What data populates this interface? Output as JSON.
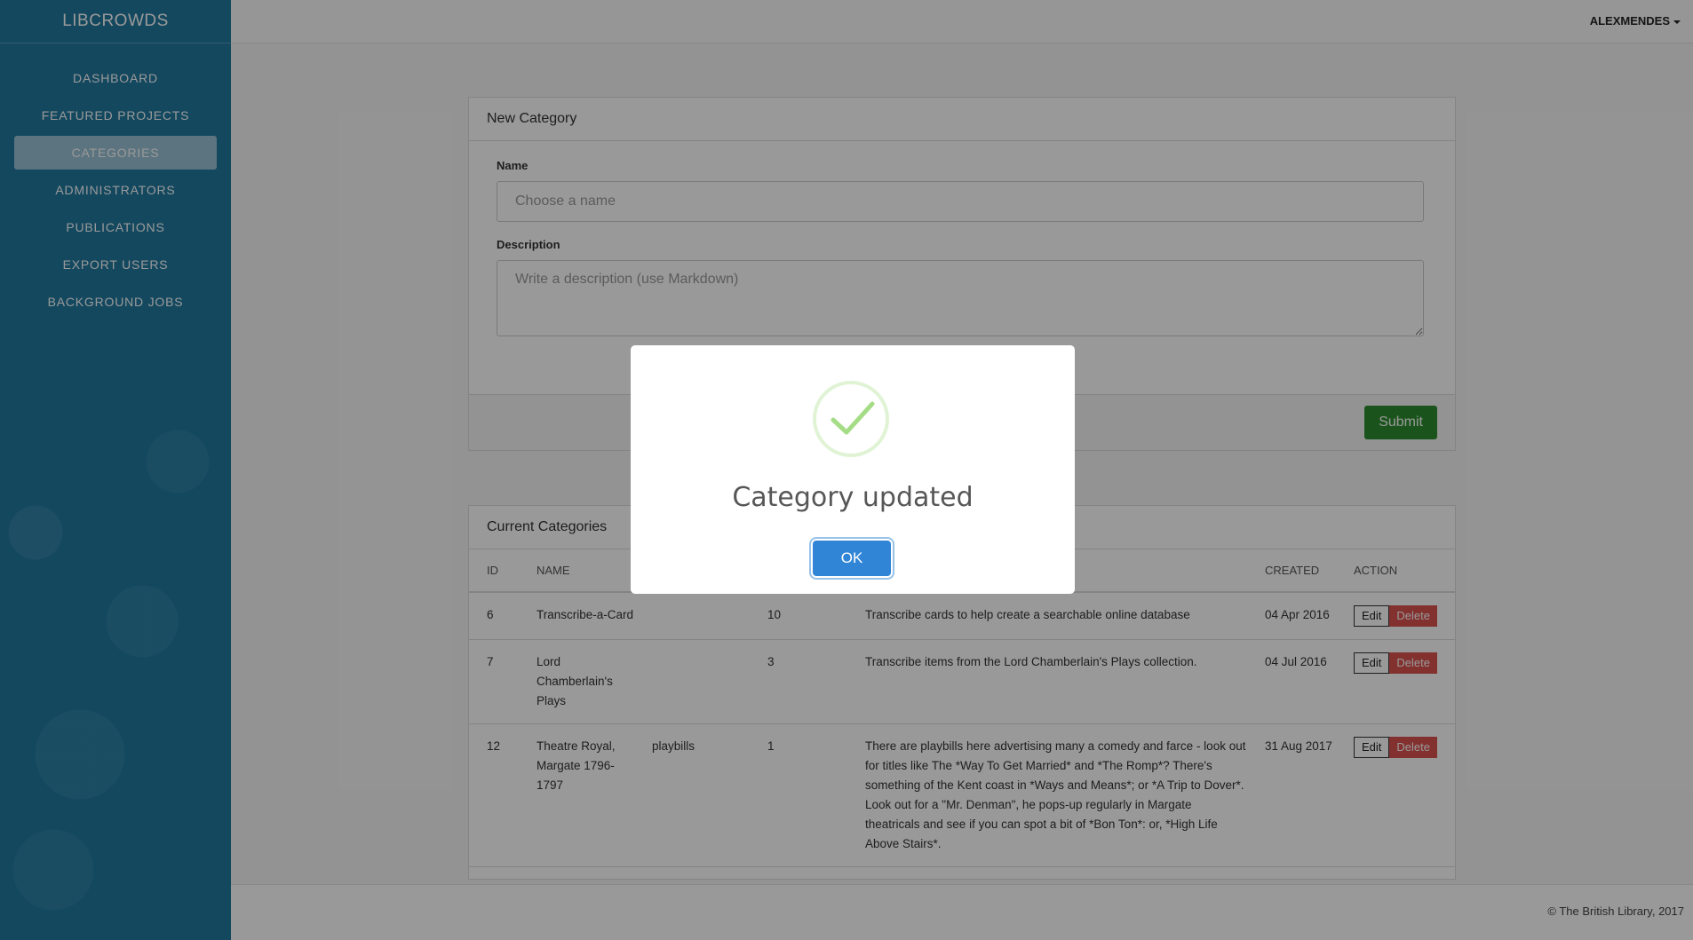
{
  "sidebar": {
    "brand": "LIBCROWDS",
    "items": [
      {
        "label": "DASHBOARD"
      },
      {
        "label": "FEATURED PROJECTS"
      },
      {
        "label": "CATEGORIES",
        "active": true
      },
      {
        "label": "ADMINISTRATORS"
      },
      {
        "label": "PUBLICATIONS"
      },
      {
        "label": "EXPORT USERS"
      },
      {
        "label": "BACKGROUND JOBS"
      }
    ]
  },
  "topbar": {
    "user": "ALEXMENDES"
  },
  "new_category": {
    "title": "New Category",
    "name_label": "Name",
    "name_placeholder": "Choose a name",
    "description_label": "Description",
    "description_placeholder": "Write a description (use Markdown)",
    "submit_label": "Submit"
  },
  "current_categories": {
    "title": "Current Categories",
    "headers": [
      "ID",
      "NAME",
      "",
      "",
      "",
      "CREATED",
      "ACTION"
    ],
    "rows": [
      {
        "id": "6",
        "name": "Transcribe-a-Card",
        "short": "",
        "count": "10",
        "description": "Transcribe cards to help create a searchable online database",
        "created": "04 Apr 2016"
      },
      {
        "id": "7",
        "name": "Lord Chamberlain's Plays",
        "short": "",
        "count": "3",
        "description": "Transcribe items from the Lord Chamberlain's Plays collection.",
        "created": "04 Jul 2016"
      },
      {
        "id": "12",
        "name": "Theatre Royal, Margate 1796-1797",
        "short": "playbills",
        "count": "1",
        "description": "There are playbills here advertising many a comedy and farce - look out for titles like The *Way To Get Married* and *The Romp*? There's something of the Kent coast in *Ways and Means*; or *A Trip to Dover*. Look out for a \"Mr. Denman\", he pops-up regularly in Margate theatricals and see if you can spot a bit of *Bon Ton*: or, *High Life Above Stairs*.",
        "created": "31 Aug 2017"
      }
    ],
    "edit_label": "Edit",
    "delete_label": "Delete"
  },
  "footer": {
    "copyright": "© The British Library, 2017"
  },
  "dialog": {
    "title": "Category updated",
    "ok_label": "OK",
    "icon": "success-check-icon"
  },
  "colors": {
    "sidebar": "#21799f",
    "submit": "#2c8d2f",
    "delete": "#d9534f",
    "ok": "#3085d6",
    "check": "#a5dc86"
  }
}
